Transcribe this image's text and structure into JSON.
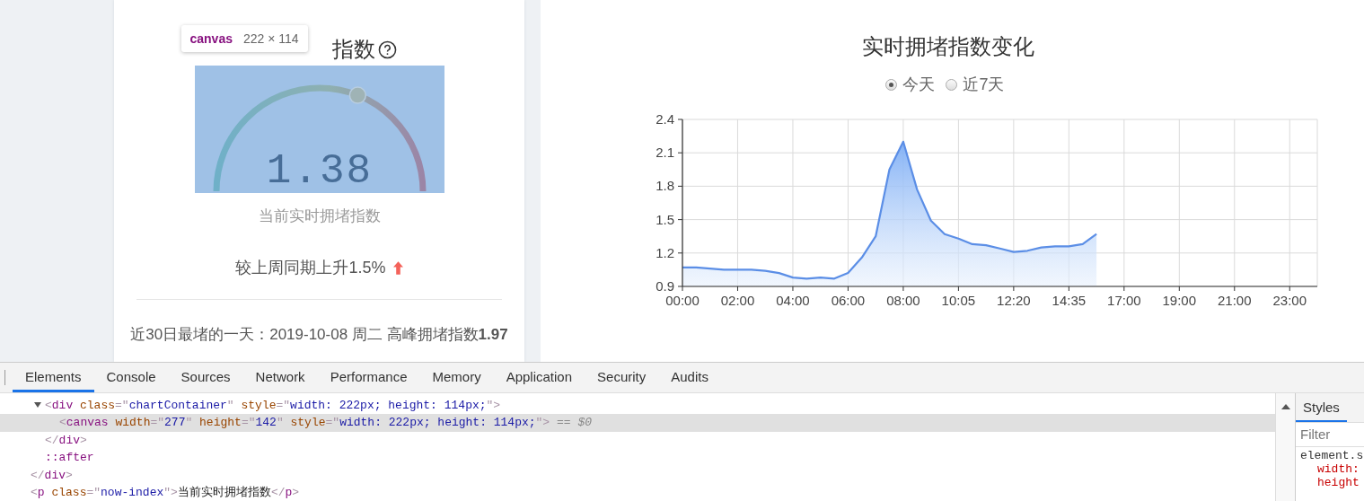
{
  "left_card": {
    "title": "指数",
    "tooltip": {
      "tag": "canvas",
      "size": "222 × 114"
    },
    "gauge": {
      "value": "1.38",
      "level": 0.62
    },
    "caption": "当前实时拥堵指数",
    "comparison": {
      "text": "较上周同期上升1.5%"
    },
    "worst_day": "近30日最堵的一天：2019-10-08 周二 高峰拥堵指数**1.97**"
  },
  "right_panel": {
    "title": "实时拥堵指数变化",
    "range_options": [
      {
        "label": "今天",
        "selected": true
      },
      {
        "label": "近7天",
        "selected": false
      }
    ],
    "chart_data": {
      "type": "area",
      "grid": true,
      "categories": [
        "00:00",
        null,
        null,
        null,
        "02:00",
        null,
        null,
        null,
        "04:00",
        null,
        null,
        null,
        "06:00",
        null,
        null,
        null,
        "08:00",
        null,
        null,
        null,
        "10:05",
        null,
        null,
        null,
        "12:20",
        null,
        null,
        null,
        "14:35",
        null,
        null,
        null,
        "17:00",
        null,
        null,
        null,
        "19:00",
        null,
        null,
        null,
        "21:00",
        null,
        null,
        null,
        "23:00",
        null
      ],
      "ylim": [
        0.9,
        2.4
      ],
      "yticks": [
        0.9,
        1.2,
        1.5,
        1.8,
        2.1,
        2.4
      ],
      "series": [
        {
          "color": "#5b8ee6",
          "values": [
            1.07,
            1.07,
            1.06,
            1.05,
            1.05,
            1.05,
            1.04,
            1.02,
            0.98,
            0.97,
            0.98,
            0.97,
            1.02,
            1.16,
            1.35,
            1.95,
            2.2,
            1.77,
            1.49,
            1.37,
            1.33,
            1.28,
            1.27,
            1.24,
            1.21,
            1.22,
            1.25,
            1.26,
            1.26,
            1.28,
            1.37,
            null,
            null,
            null,
            null,
            null,
            null,
            null,
            null,
            null,
            null,
            null,
            null,
            null,
            null,
            null
          ]
        }
      ]
    }
  },
  "devtools": {
    "tabs": [
      {
        "label": "Elements",
        "selected": true
      },
      {
        "label": "Console",
        "selected": false
      },
      {
        "label": "Sources",
        "selected": false
      },
      {
        "label": "Network",
        "selected": false
      },
      {
        "label": "Performance",
        "selected": false
      },
      {
        "label": "Memory",
        "selected": false
      },
      {
        "label": "Application",
        "selected": false
      },
      {
        "label": "Security",
        "selected": false
      },
      {
        "label": "Audits",
        "selected": false
      }
    ],
    "dom_tree": [
      {
        "children": [
          {
            "expanded": true,
            "selected": false,
            "tokens": [
              {
                "kind": "punct",
                "text": "<"
              },
              {
                "kind": "tag",
                "text": "div"
              },
              {
                "kind": "attr",
                "text": " class"
              },
              {
                "kind": "punct",
                "text": "=\""
              },
              {
                "kind": "value",
                "text": "chartContainer"
              },
              {
                "kind": "punct",
                "text": "\""
              },
              {
                "kind": "attr",
                "text": " style"
              },
              {
                "kind": "punct",
                "text": "=\""
              },
              {
                "kind": "value",
                "text": "width: 222px; height: 114px;"
              },
              {
                "kind": "punct",
                "text": "\">"
              }
            ],
            "children": [
              {
                "selected": true,
                "tokens": [
                  {
                    "kind": "punct",
                    "text": "<"
                  },
                  {
                    "kind": "tag",
                    "text": "canvas"
                  },
                  {
                    "kind": "attr",
                    "text": " width"
                  },
                  {
                    "kind": "punct",
                    "text": "=\""
                  },
                  {
                    "kind": "value",
                    "text": "277"
                  },
                  {
                    "kind": "punct",
                    "text": "\""
                  },
                  {
                    "kind": "attr",
                    "text": " height"
                  },
                  {
                    "kind": "punct",
                    "text": "=\""
                  },
                  {
                    "kind": "value",
                    "text": "142"
                  },
                  {
                    "kind": "punct",
                    "text": "\""
                  },
                  {
                    "kind": "attr",
                    "text": " style"
                  },
                  {
                    "kind": "punct",
                    "text": "=\""
                  },
                  {
                    "kind": "value",
                    "text": "width: 222px; height: 114px;"
                  },
                  {
                    "kind": "punct",
                    "text": "\">"
                  },
                  {
                    "kind": "note",
                    "text": " == $0"
                  }
                ]
              }
            ],
            "close": [
              {
                "kind": "punct",
                "text": "</"
              },
              {
                "kind": "tag",
                "text": "div"
              },
              {
                "kind": "punct",
                "text": ">"
              }
            ]
          },
          {
            "selected": false,
            "tokens": [
              {
                "kind": "tag",
                "text": "::after"
              }
            ]
          }
        ],
        "close": [
          {
            "kind": "punct",
            "text": "</"
          },
          {
            "kind": "tag",
            "text": "div"
          },
          {
            "kind": "punct",
            "text": ">"
          }
        ]
      },
      {
        "selected": false,
        "tokens": [
          {
            "kind": "punct",
            "text": "<"
          },
          {
            "kind": "tag",
            "text": "p"
          },
          {
            "kind": "attr",
            "text": " class"
          },
          {
            "kind": "punct",
            "text": "=\""
          },
          {
            "kind": "value",
            "text": "now-index"
          },
          {
            "kind": "punct",
            "text": "\">"
          },
          {
            "kind": "text",
            "text": "当前实时拥堵指数"
          },
          {
            "kind": "punct",
            "text": "</"
          },
          {
            "kind": "tag",
            "text": "p"
          },
          {
            "kind": "punct",
            "text": ">"
          }
        ]
      }
    ],
    "styles_pane": {
      "tabs": [
        {
          "label": "Styles",
          "selected": true
        }
      ],
      "filter_placeholder": "Filter",
      "rule_selector": "element.s",
      "properties": [
        "width:",
        "height"
      ]
    }
  }
}
